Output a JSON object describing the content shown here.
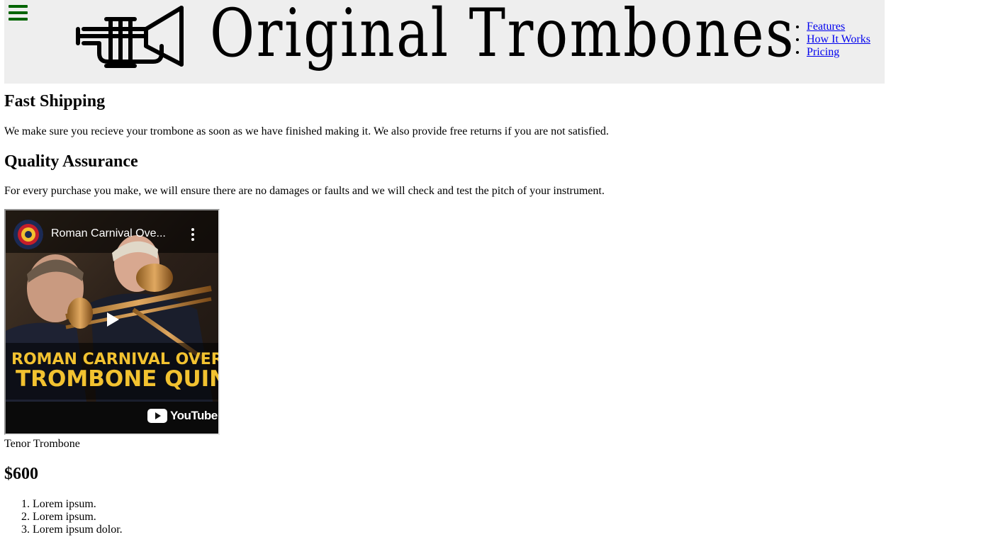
{
  "header": {
    "logo_text": "Original Trombones",
    "nav": [
      {
        "label": "Features"
      },
      {
        "label": "How It Works"
      },
      {
        "label": "Pricing"
      }
    ]
  },
  "sections": {
    "shipping": {
      "title": "Fast Shipping",
      "text": "We make sure you recieve your trombone as soon as we have finished making it. We also provide free returns if you are not satisfied."
    },
    "quality": {
      "title": "Quality Assurance",
      "text": "For every purchase you make, we will ensure there are no damages or faults and we will check and test the pitch of your instrument."
    }
  },
  "video": {
    "title": "Roman Carnival Ove...",
    "overlay_line1": "ROMAN CARNIVAL OVERT",
    "overlay_line2": "TROMBONE QUINT",
    "platform": "YouTube"
  },
  "product": {
    "name": "Tenor Trombone",
    "price": "$600",
    "features": [
      "Lorem ipsum.",
      "Lorem ipsum.",
      "Lorem ipsum dolor."
    ]
  },
  "colors": {
    "header_bg": "#eeeeee",
    "hamburger": "#006400",
    "link": "#0000ee",
    "overlay_text": "#f2c230"
  },
  "icons": [
    "hamburger-menu-icon",
    "trumpet-logo-icon",
    "play-icon",
    "kebab-menu-icon",
    "youtube-logo-icon"
  ]
}
